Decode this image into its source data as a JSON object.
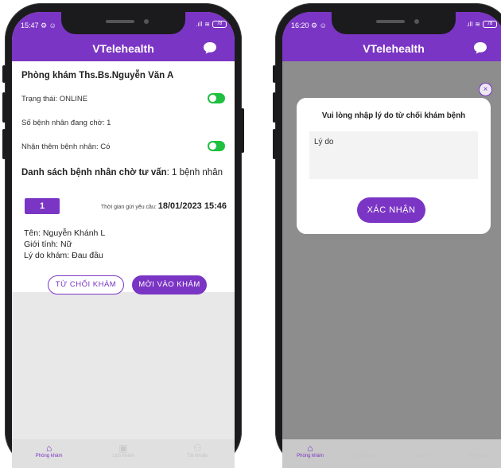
{
  "left_phone": {
    "status": {
      "time": "15:47 ⚙ ☺",
      "signal": ".ıll",
      "wifi": "≋",
      "battery": "78"
    },
    "header": {
      "title": "VTelehealth"
    },
    "clinic": {
      "name": "Phòng khám Ths.Bs.Nguyễn Văn A",
      "status_label": "Trạng thái: ONLINE",
      "waiting_label": "Số bệnh nhân đang chờ: 1",
      "accept_label": "Nhận thêm bệnh nhân: Có",
      "list_label_bold": "Danh sách bệnh nhân chờ tư vấn",
      "list_label_rest": ": 1 bệnh nhân",
      "status_on": true,
      "accept_on": true
    },
    "request": {
      "number": "1",
      "time_label": "Thời gian gửi yêu cầu:",
      "time_value": "18/01/2023 15:46",
      "name": "Tên: Nguyễn Khánh L",
      "gender": "Giới tính: Nữ",
      "reason": "Lý do khám: Đau đầu",
      "reject_label": "TỪ CHỐI KHÁM",
      "invite_label": "MỜI VÀO KHÁM"
    },
    "tabs": [
      {
        "label": "Phòng khám",
        "icon": "⌂",
        "active": true
      },
      {
        "label": "Lịch khám",
        "icon": "▣",
        "active": false
      },
      {
        "label": "Tài khoản",
        "icon": "⚇",
        "active": false
      }
    ]
  },
  "right_phone": {
    "status": {
      "time": "16:20 ⚙ ☺",
      "signal": ".ıll",
      "wifi": "≋",
      "battery": "78"
    },
    "header": {
      "title": "VTelehealth"
    },
    "modal": {
      "close_glyph": "×",
      "title": "Vui lòng nhập lý do từ chối khám bệnh",
      "placeholder": "Lý do",
      "confirm_label": "XÁC NHẬN"
    },
    "tabs": [
      {
        "label": "Phòng khám",
        "icon": "⌂",
        "active": true
      },
      {
        "label": "Lịch khám",
        "icon": "▣",
        "active": false
      },
      {
        "label": "Bác sĩ",
        "icon": "⚕",
        "active": false
      },
      {
        "label": "Tài khoản",
        "icon": "⚇",
        "active": false
      }
    ]
  },
  "colors": {
    "primary": "#7b35c4",
    "toggle_on": "#1fbf3f",
    "overlay": "#8d8d8d"
  }
}
